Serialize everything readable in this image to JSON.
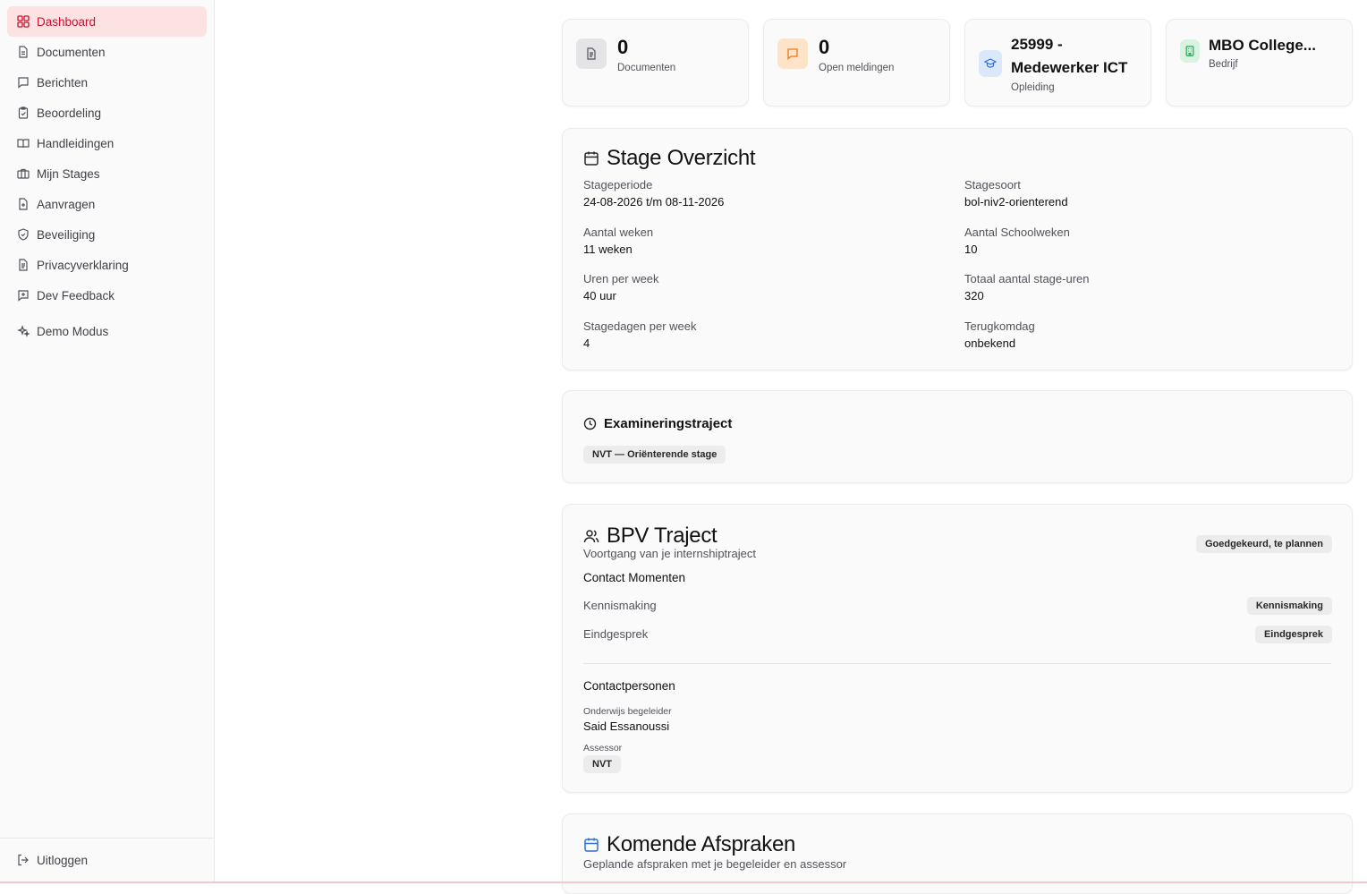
{
  "sidebar": {
    "items": [
      {
        "label": "Dashboard",
        "icon": "grid-icon"
      },
      {
        "label": "Documenten",
        "icon": "file-icon"
      },
      {
        "label": "Berichten",
        "icon": "message-icon"
      },
      {
        "label": "Beoordeling",
        "icon": "clipboard-check-icon"
      },
      {
        "label": "Handleidingen",
        "icon": "book-icon"
      },
      {
        "label": "Mijn Stages",
        "icon": "briefcase-icon"
      },
      {
        "label": "Aanvragen",
        "icon": "file-plus-icon"
      },
      {
        "label": "Beveiliging",
        "icon": "shield-icon"
      },
      {
        "label": "Privacyverklaring",
        "icon": "file-text-icon"
      },
      {
        "label": "Dev Feedback",
        "icon": "message-plus-icon"
      },
      {
        "label": "Demo Modus",
        "icon": "sparkles-icon"
      }
    ],
    "logout_label": "Uitloggen",
    "accent": "#c8102e"
  },
  "stats": {
    "documents": {
      "number": "0",
      "label": "Documenten"
    },
    "reports": {
      "number": "0",
      "label": "Open meldingen"
    },
    "education": {
      "title_line1": "25999 -",
      "title_line2": "Medewerker ICT",
      "label": "Opleiding"
    },
    "company": {
      "title": "MBO College...",
      "label": "Bedrijf"
    }
  },
  "stage_overview": {
    "title": "Stage Overzicht",
    "fields": [
      {
        "label": "Stageperiode",
        "value": "24-08-2026 t/m 08-11-2026"
      },
      {
        "label": "Stagesoort",
        "value": "bol-niv2-orienterend"
      },
      {
        "label": "Aantal weken",
        "value": "11 weken"
      },
      {
        "label": "Aantal Schoolweken",
        "value": "10"
      },
      {
        "label": "Uren per week",
        "value": "40 uur"
      },
      {
        "label": "Totaal aantal stage-uren",
        "value": "320"
      },
      {
        "label": "Stagedagen per week",
        "value": "4"
      },
      {
        "label": "Terugkomdag",
        "value": "onbekend"
      }
    ]
  },
  "exam": {
    "title": "Examineringstraject",
    "badge": "NVT — Oriënterende stage"
  },
  "bpv": {
    "title": "BPV Traject",
    "subtitle": "Voortgang van je internshiptraject",
    "status_badge": "Goedgekeurd, te plannen",
    "contact_moments_title": "Contact Momenten",
    "moments": [
      {
        "label": "Kennismaking",
        "badge": "Kennismaking"
      },
      {
        "label": "Eindgesprek",
        "badge": "Eindgesprek"
      }
    ],
    "contacts_title": "Contactpersonen",
    "teacher_label": "Onderwijs begeleider",
    "teacher_name": "Said Essanoussi",
    "assessor_label": "Assessor",
    "assessor_badge": "NVT"
  },
  "appointments": {
    "title": "Komende Afspraken",
    "subtitle": "Geplande afspraken met je begeleider en assessor"
  }
}
